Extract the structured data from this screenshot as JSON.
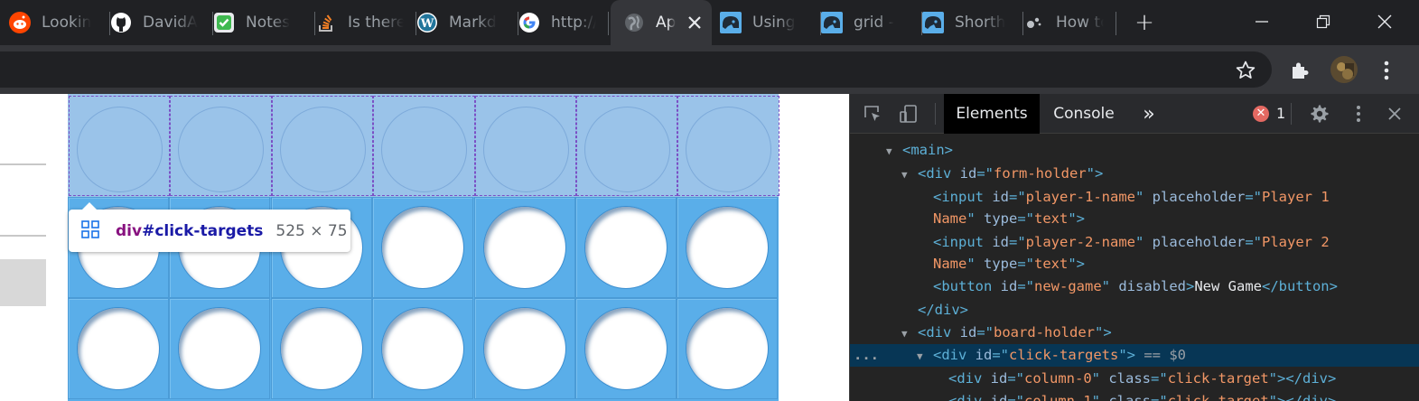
{
  "tabs": [
    {
      "label": "Lookin",
      "icon": "reddit-icon",
      "color": "#ff4500"
    },
    {
      "label": "DavidA",
      "icon": "github-icon",
      "color": "#ffffff"
    },
    {
      "label": "Notes",
      "icon": "notes-check-icon",
      "color": "#3fb950"
    },
    {
      "label": "Is there",
      "icon": "stackoverflow-icon",
      "color": "#f48024"
    },
    {
      "label": "Markd",
      "icon": "wordpress-icon",
      "color": "#21759b"
    },
    {
      "label": "http://",
      "icon": "google-icon",
      "color": "#4285f4"
    },
    {
      "label": "Ap",
      "icon": "globe-icon",
      "color": "#9aa0a6",
      "active": true
    },
    {
      "label": "Using",
      "icon": "helmet-icon",
      "color": "#5aaee9"
    },
    {
      "label": "grid -",
      "icon": "helmet-icon",
      "color": "#5aaee9"
    },
    {
      "label": "Shorth",
      "icon": "helmet-icon",
      "color": "#5aaee9"
    },
    {
      "label": "How to",
      "icon": "dots-icon",
      "color": "#9aa0a6"
    }
  ],
  "tooltip": {
    "tag": "div",
    "id": "#click-targets",
    "size": "525 × 75"
  },
  "board": {
    "columns": 7,
    "filled_rows_visible": 2
  },
  "devtools": {
    "tabs": {
      "elements": "Elements",
      "console": "Console",
      "more": "»"
    },
    "error_count": "1",
    "tree": [
      {
        "indent": 2,
        "twisty": "▼",
        "parts": [
          [
            "t",
            "<main>"
          ]
        ]
      },
      {
        "indent": 3,
        "twisty": "▼",
        "parts": [
          [
            "t",
            "<div "
          ],
          [
            "a",
            "id"
          ],
          [
            "t",
            "=\""
          ],
          [
            "v",
            "form-holder"
          ],
          [
            "t",
            "\">"
          ]
        ]
      },
      {
        "indent": 4,
        "twisty": "",
        "parts": [
          [
            "t",
            "<input "
          ],
          [
            "a",
            "id"
          ],
          [
            "t",
            "=\""
          ],
          [
            "v",
            "player-1-name"
          ],
          [
            "t",
            "\" "
          ],
          [
            "a",
            "placeholder"
          ],
          [
            "t",
            "=\""
          ],
          [
            "v",
            "Player 1"
          ]
        ]
      },
      {
        "indent": 4,
        "twisty": "",
        "parts": [
          [
            "v",
            "Name"
          ],
          [
            "t",
            "\" "
          ],
          [
            "a",
            "type"
          ],
          [
            "t",
            "=\""
          ],
          [
            "v",
            "text"
          ],
          [
            "t",
            "\">"
          ]
        ]
      },
      {
        "indent": 4,
        "twisty": "",
        "parts": [
          [
            "t",
            "<input "
          ],
          [
            "a",
            "id"
          ],
          [
            "t",
            "=\""
          ],
          [
            "v",
            "player-2-name"
          ],
          [
            "t",
            "\" "
          ],
          [
            "a",
            "placeholder"
          ],
          [
            "t",
            "=\""
          ],
          [
            "v",
            "Player 2"
          ]
        ]
      },
      {
        "indent": 4,
        "twisty": "",
        "parts": [
          [
            "v",
            "Name"
          ],
          [
            "t",
            "\" "
          ],
          [
            "a",
            "type"
          ],
          [
            "t",
            "=\""
          ],
          [
            "v",
            "text"
          ],
          [
            "t",
            "\">"
          ]
        ]
      },
      {
        "indent": 4,
        "twisty": "",
        "parts": [
          [
            "t",
            "<button "
          ],
          [
            "a",
            "id"
          ],
          [
            "t",
            "=\""
          ],
          [
            "v",
            "new-game"
          ],
          [
            "t",
            "\" "
          ],
          [
            "a",
            "disabled"
          ],
          [
            "t",
            ">"
          ],
          [
            "txt",
            "New Game"
          ],
          [
            "t",
            "</button>"
          ]
        ]
      },
      {
        "indent": 3,
        "twisty": "",
        "parts": [
          [
            "t",
            "</div>"
          ]
        ]
      },
      {
        "indent": 3,
        "twisty": "▼",
        "parts": [
          [
            "t",
            "<div "
          ],
          [
            "a",
            "id"
          ],
          [
            "t",
            "=\""
          ],
          [
            "v",
            "board-holder"
          ],
          [
            "t",
            "\">"
          ]
        ]
      },
      {
        "indent": 4,
        "twisty": "▼",
        "selected": true,
        "parts": [
          [
            "t",
            "<div "
          ],
          [
            "a",
            "id"
          ],
          [
            "t",
            "=\""
          ],
          [
            "v",
            "click-targets"
          ],
          [
            "t",
            "\">"
          ],
          [
            "e",
            " == $0"
          ]
        ]
      },
      {
        "indent": 5,
        "twisty": "",
        "parts": [
          [
            "t",
            "<div "
          ],
          [
            "a",
            "id"
          ],
          [
            "t",
            "=\""
          ],
          [
            "v",
            "column-0"
          ],
          [
            "t",
            "\" "
          ],
          [
            "a",
            "class"
          ],
          [
            "t",
            "=\""
          ],
          [
            "v",
            "click-target"
          ],
          [
            "t",
            "\"></div>"
          ]
        ]
      },
      {
        "indent": 5,
        "twisty": "",
        "parts": [
          [
            "t",
            "<div "
          ],
          [
            "a",
            "id"
          ],
          [
            "t",
            "=\""
          ],
          [
            "v",
            "column-1"
          ],
          [
            "t",
            "\" "
          ],
          [
            "a",
            "class"
          ],
          [
            "t",
            "=\""
          ],
          [
            "v",
            "click-target"
          ],
          [
            "t",
            "\"></div>"
          ]
        ]
      }
    ],
    "selected_marker": "..."
  }
}
